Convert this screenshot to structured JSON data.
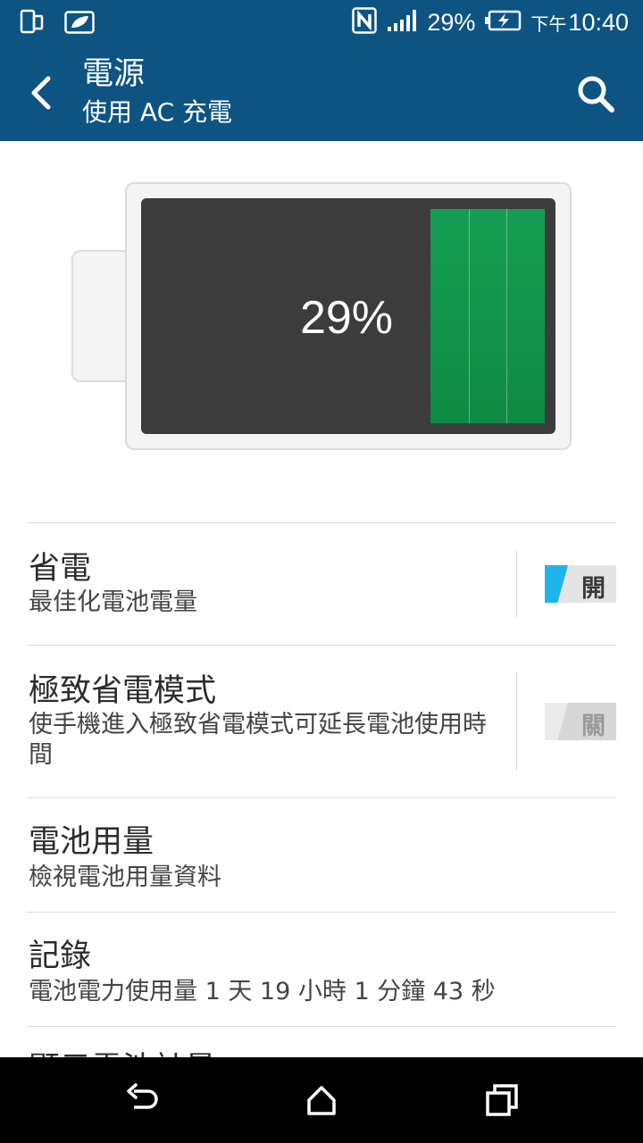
{
  "status_bar": {
    "battery_percent": "29%",
    "time_prefix": "下午",
    "time": "10:40",
    "icons": [
      "phone-icon",
      "leaf-icon",
      "nfc-icon",
      "signal-icon",
      "battery-charging-icon"
    ]
  },
  "app_bar": {
    "title": "電源",
    "subtitle": "使用 AC 充電",
    "back_icon": "chevron-left-icon",
    "search_icon": "search-icon"
  },
  "battery": {
    "level_text": "29%",
    "level_fraction": 0.29,
    "fill_color": "#159e52"
  },
  "settings": [
    {
      "title": "省電",
      "subtitle": "最佳化電池電量",
      "toggle": "開",
      "toggle_on": true
    },
    {
      "title": "極致省電模式",
      "subtitle": "使手機進入極致省電模式可延長電池使用時間",
      "toggle": "關",
      "toggle_on": false
    },
    {
      "title": "電池用量",
      "subtitle": "檢視電池用量資料"
    },
    {
      "title": "記錄",
      "subtitle": "電池電力使用量 1 天 19 小時 1 分鐘 43 秒"
    },
    {
      "title": "顯示電池計量"
    }
  ],
  "nav_bar": {
    "back_icon": "back-arrow-icon",
    "home_icon": "home-icon",
    "recents_icon": "recents-icon"
  },
  "colors": {
    "app_bar": "#0e5482",
    "toggle_on": "#1eb4ea"
  }
}
